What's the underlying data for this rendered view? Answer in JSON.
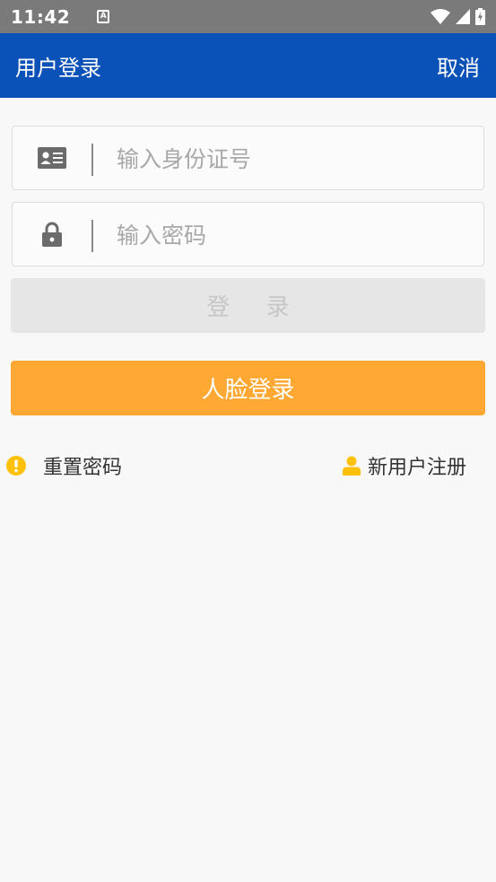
{
  "status_bar": {
    "time": "11:42",
    "notification_icon_letter": "A",
    "icons": [
      "wifi-icon",
      "signal-icon",
      "battery-charging-icon"
    ]
  },
  "app_bar": {
    "title": "用户登录",
    "cancel_label": "取消",
    "background_color": "#0b52b8"
  },
  "form": {
    "id_field": {
      "placeholder": "输入身份证号",
      "value": "",
      "icon": "id-card-icon"
    },
    "password_field": {
      "placeholder": "输入密码",
      "value": "",
      "icon": "lock-icon"
    },
    "login_button_label": "登 录",
    "face_login_button_label": "人脸登录",
    "face_login_color": "#ffa833"
  },
  "links": {
    "reset_password": {
      "label": "重置密码",
      "icon": "alert-circle-icon",
      "icon_color": "#ffc107"
    },
    "register": {
      "label": "新用户注册",
      "icon": "user-icon",
      "icon_color": "#ffc107"
    }
  }
}
